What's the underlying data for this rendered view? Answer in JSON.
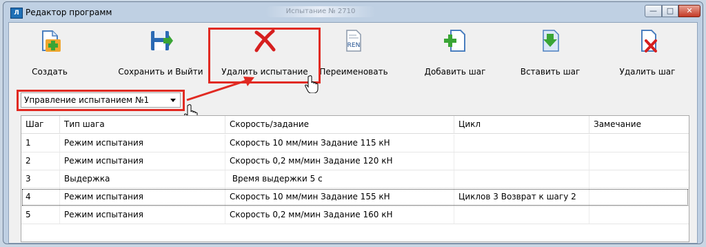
{
  "window": {
    "title": "Редактор программ",
    "app_icon_text": "Л",
    "blurred_title": "Испытание № 2710"
  },
  "toolbar": [
    {
      "id": "create",
      "label": "Создать",
      "icon": "create-file-plus-icon"
    },
    {
      "id": "save-exit",
      "label": "Сохранить и Выйти",
      "icon": "floppy-save-icon"
    },
    {
      "id": "delete-test",
      "label": "Удалить испытание",
      "icon": "red-x-icon"
    },
    {
      "id": "rename",
      "label": "Переименовать",
      "icon": "rename-ren-icon"
    },
    {
      "id": "add-step",
      "label": "Добавить шаг",
      "icon": "add-step-plus-icon"
    },
    {
      "id": "insert-step",
      "label": "Вставить шаг",
      "icon": "insert-step-icon"
    },
    {
      "id": "delete-step",
      "label": "Удалить шаг",
      "icon": "delete-step-x-icon"
    }
  ],
  "rename_icon_text": "REN",
  "test_select": {
    "value": "Управление испытанием №1"
  },
  "table": {
    "columns": [
      "Шаг",
      "Тип шага",
      "Скорость/задание",
      "Цикл",
      "Замечание"
    ],
    "rows": [
      {
        "step": "1",
        "type": "Режим испытания",
        "speed": "Скорость 10 мм/мин Задание 115 кН",
        "cycle": "",
        "note": ""
      },
      {
        "step": "2",
        "type": "Режим испытания",
        "speed": "Скорость 0,2 мм/мин Задание 120 кН",
        "cycle": "",
        "note": ""
      },
      {
        "step": "3",
        "type": "Выдержка",
        "speed": " Время выдержки 5 с",
        "cycle": "",
        "note": ""
      },
      {
        "step": "4",
        "type": "Режим испытания",
        "speed": "Скорость 10 мм/мин Задание 155 кН",
        "cycle": "Циклов 3 Возврат к шагу 2",
        "note": ""
      },
      {
        "step": "5",
        "type": "Режим испытания",
        "speed": "Скорость 0,2 мм/мин Задание 160 кН",
        "cycle": "",
        "note": ""
      }
    ],
    "selected_row": 4
  },
  "colors": {
    "highlight": "#e12a22",
    "accent_green": "#3aa535",
    "accent_blue": "#1f6fb5"
  }
}
